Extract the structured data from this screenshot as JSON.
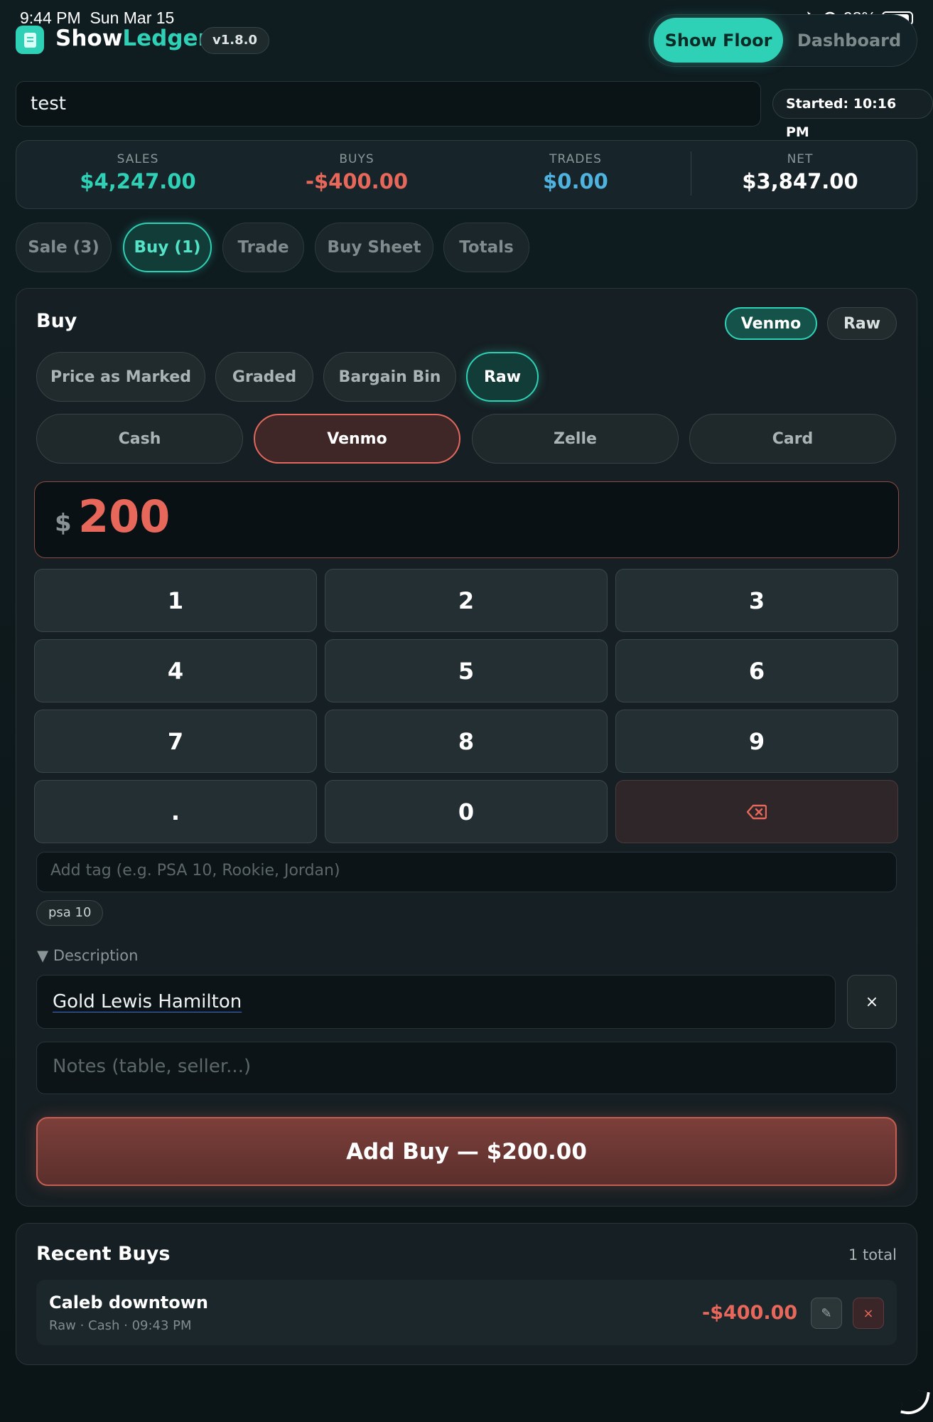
{
  "status_bar": {
    "time": "9:44 PM",
    "date": "Sun Mar 15",
    "battery": "98%",
    "icons": [
      "airplane-icon",
      "headphones-icon",
      "battery-icon"
    ]
  },
  "header": {
    "app_name_a": "Show",
    "app_name_b": "Ledger",
    "version": "v1.8.0",
    "modes": [
      "Show Floor",
      "Dashboard"
    ]
  },
  "session": {
    "name": "test",
    "started": "Started: 10:16 PM"
  },
  "stats": [
    {
      "label": "SALES",
      "value": "$4,247.00",
      "color": "#2fd1b6"
    },
    {
      "label": "BUYS",
      "value": "-$400.00",
      "color": "#e8675b"
    },
    {
      "label": "TRADES",
      "value": "$0.00",
      "color": "#4fb3e0"
    },
    {
      "label": "NET",
      "value": "$3,847.00",
      "color": "#ffffff"
    }
  ],
  "tabs": [
    "Sale (3)",
    "Buy (1)",
    "Trade",
    "Buy Sheet",
    "Totals"
  ],
  "buy": {
    "title": "Buy",
    "quick_chips": [
      "Venmo",
      "Raw"
    ],
    "categories": [
      "Price as Marked",
      "Graded",
      "Bargain Bin",
      "Raw"
    ],
    "payments": [
      "Cash",
      "Venmo",
      "Zelle",
      "Card"
    ],
    "currency": "$",
    "amount": "200",
    "keys": [
      "1",
      "2",
      "3",
      "4",
      "5",
      "6",
      "7",
      "8",
      "9",
      ".",
      "0"
    ],
    "tag_placeholder": "Add tag (e.g. PSA 10, Rookie, Jordan)",
    "tag": "psa 10",
    "description_toggle": "▼ Description",
    "description": "Gold Lewis Hamilton",
    "clear_symbol": "×",
    "notes_placeholder": "Notes (table, seller...)",
    "add_button": "Add Buy — $200.00"
  },
  "recent": {
    "title": "Recent Buys",
    "count": "1 total",
    "items": [
      {
        "name": "Caleb downtown",
        "meta": "Raw · Cash · 09:43 PM",
        "amount": "-$400.00"
      }
    ]
  },
  "colors": {
    "accent": "#2fd1b6",
    "negative": "#e8675b",
    "trades": "#4fb3e0"
  }
}
